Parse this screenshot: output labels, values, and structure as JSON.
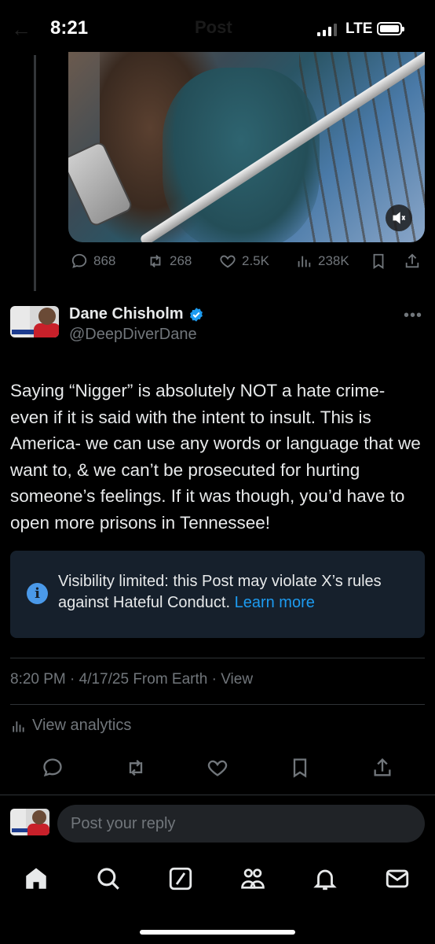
{
  "status_bar": {
    "time": "8:21",
    "network": "LTE",
    "ghost_title": "Post"
  },
  "video": {
    "mute_icon": "speaker-mute-icon"
  },
  "parent_actions": {
    "replies": "868",
    "reposts": "268",
    "likes": "2.5K",
    "views": "238K"
  },
  "post": {
    "author_name": "Dane Chisholm",
    "handle": "@DeepDiverDane",
    "text": "Saying “Nigger” is absolutely NOT a hate crime- even if it is said with the intent to insult. This is America- we can use any words or language that we want to, & we can’t be prosecuted for hurting someone’s feelings. If it was though, you’d have to open more prisons in Tennessee!",
    "visibility_notice": "Visibility limited: this Post may violate X’s rules against Hateful Conduct.",
    "learn_more": "Learn more",
    "meta": "8:20 PM · 4/17/25 From Earth · View",
    "analytics": "View analytics"
  },
  "reply": {
    "placeholder": "Post your reply"
  },
  "colors": {
    "accent": "#1d9bf0",
    "muted": "#71767b",
    "notice_bg": "#16202c",
    "info": "#4a99e9"
  }
}
